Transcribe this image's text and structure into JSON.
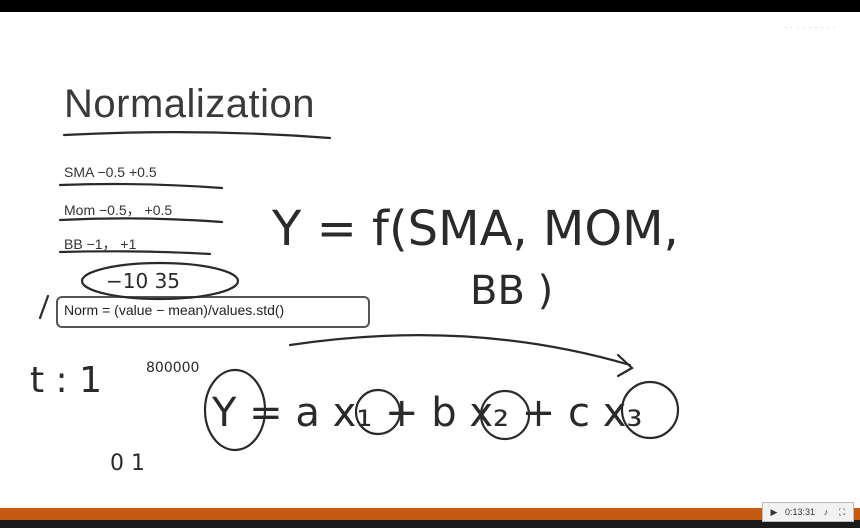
{
  "slide": {
    "title": "Normalization",
    "bullets": [
      "SMA −0.5 +0.5",
      "Mom −0.5， +0.5",
      "BB −1， +1"
    ],
    "formula": "Norm = (value − mean)/values.std()"
  },
  "handwriting": {
    "range": "−10  35",
    "y_equals": "Y = f(SMA, MOM,",
    "bb": "BB )",
    "t1": "t : 1",
    "t1_tail": "800000",
    "zero_one": "0  1",
    "linear": "Y = a x₁ + b x₂ + c x₃"
  },
  "player": {
    "time": "0:13:31",
    "icons": [
      "play-icon",
      "volume-icon",
      "fullscreen-icon"
    ]
  },
  "colors": {
    "accent_bar": "#c55a11",
    "ink": "#2a2a2a"
  }
}
